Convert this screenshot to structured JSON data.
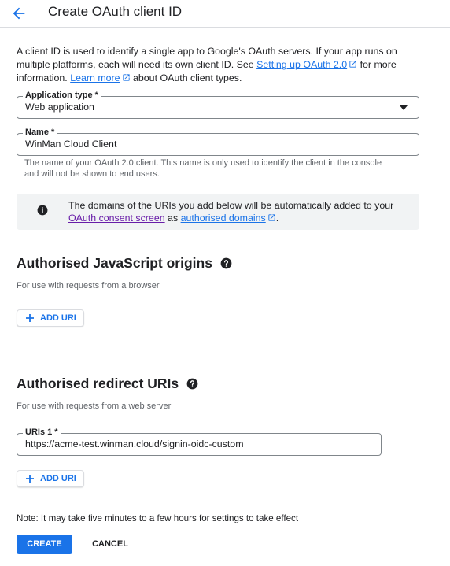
{
  "header": {
    "title": "Create OAuth client ID",
    "back_icon": "arrow-back-icon"
  },
  "intro": {
    "text_before": "A client ID is used to identify a single app to Google's OAuth servers. If your app runs on multiple platforms, each will need its own client ID. See ",
    "link1": "Setting up OAuth 2.0",
    "text_middle": " for more information. ",
    "link2": "Learn more",
    "text_after": " about OAuth client types."
  },
  "application_type": {
    "label": "Application type *",
    "value": "Web application"
  },
  "name_field": {
    "label": "Name *",
    "value": "WinMan Cloud Client",
    "helper": "The name of your OAuth 2.0 client. This name is only used to identify the client in the console and will not be shown to end users."
  },
  "info_box": {
    "text_before": "The domains of the URIs you add below will be automatically added to your ",
    "link1": "OAuth consent screen",
    "text_middle": " as ",
    "link2": "authorised domains",
    "text_after": "."
  },
  "js_origins": {
    "title": "Authorised JavaScript origins",
    "subtitle": "For use with requests from a browser",
    "add_label": "ADD URI"
  },
  "redirect_uris": {
    "title": "Authorised redirect URIs",
    "subtitle": "For use with requests from a web server",
    "field_label": "URIs 1 *",
    "field_value": "https://acme-test.winman.cloud/signin-oidc-custom",
    "add_label": "ADD URI"
  },
  "note": "Note: It may take five minutes to a few hours for settings to take effect",
  "actions": {
    "create": "CREATE",
    "cancel": "CANCEL"
  },
  "colors": {
    "accent": "#1a73e8",
    "visited_link": "#681da8",
    "info_bg": "#f1f3f4",
    "border": "#80868b"
  }
}
